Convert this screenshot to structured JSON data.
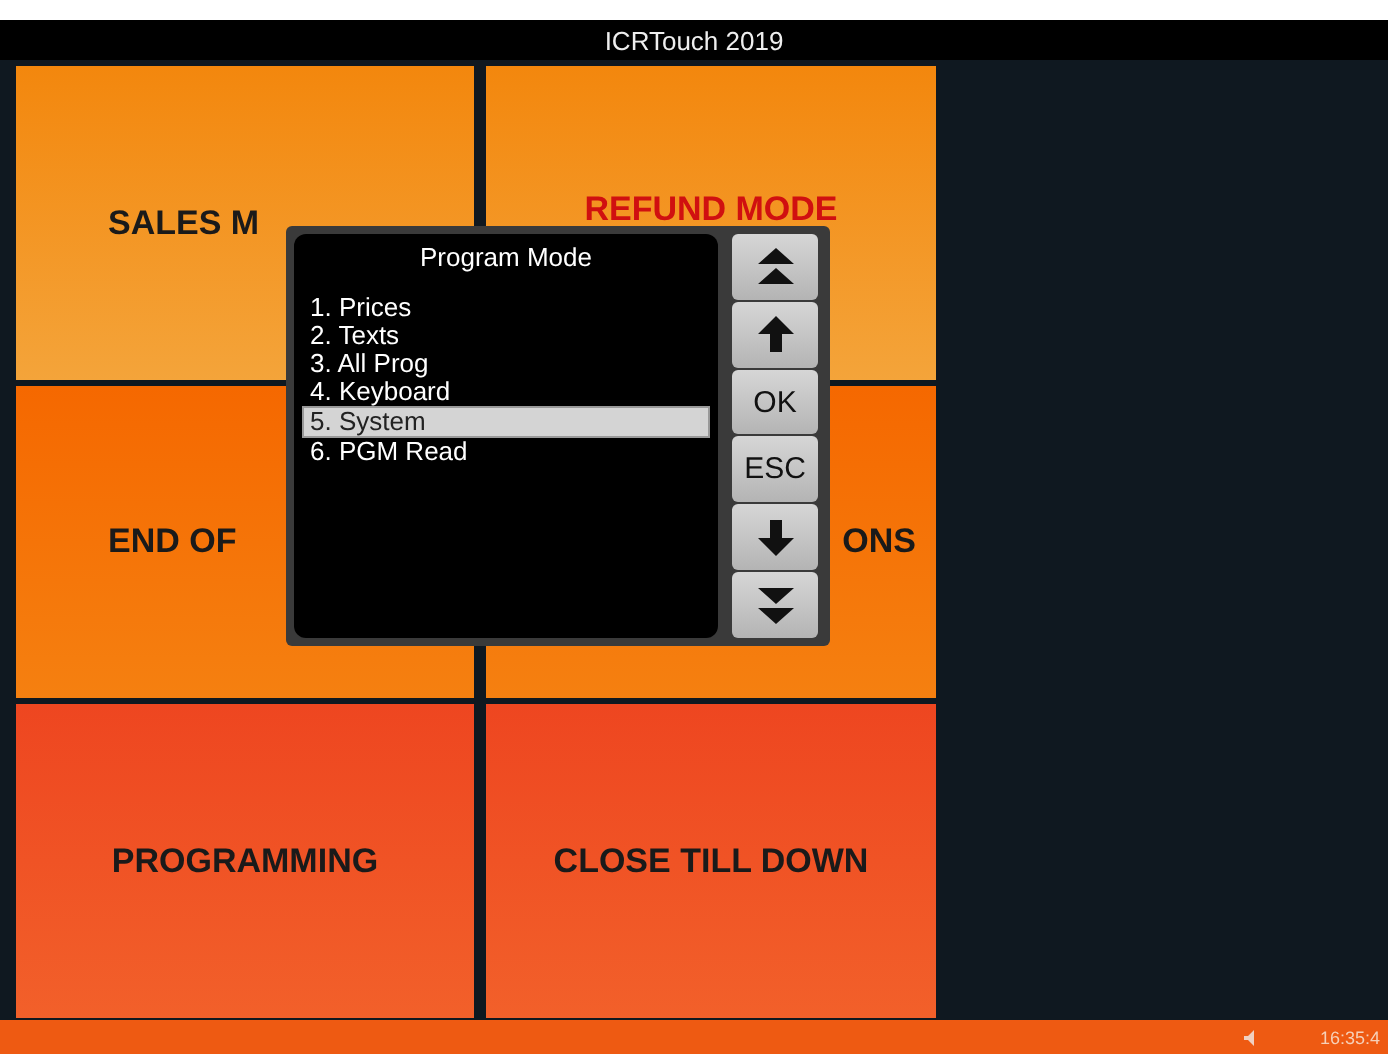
{
  "window": {
    "title": "ICRTouch 2019"
  },
  "tiles": [
    {
      "label": "SALES M",
      "color": "#1a1a1a"
    },
    {
      "label": "REFUND MODE",
      "color": "#d01010"
    },
    {
      "label": "END OF",
      "color": "#1a1a1a"
    },
    {
      "label": "ONS",
      "color": "#1a1a1a"
    },
    {
      "label": "PROGRAMMING",
      "color": "#1a1a1a"
    },
    {
      "label": "CLOSE TILL DOWN",
      "color": "#1a1a1a"
    }
  ],
  "dialog": {
    "title": "Program Mode",
    "items": [
      {
        "label": "1. Prices",
        "selected": false
      },
      {
        "label": "2. Texts",
        "selected": false
      },
      {
        "label": "3. All Prog",
        "selected": false
      },
      {
        "label": "4. Keyboard",
        "selected": false
      },
      {
        "label": "5. System",
        "selected": true
      },
      {
        "label": "6. PGM Read",
        "selected": false
      }
    ],
    "buttons": [
      {
        "kind": "first"
      },
      {
        "kind": "up"
      },
      {
        "kind": "text",
        "label": "OK"
      },
      {
        "kind": "text",
        "label": "ESC"
      },
      {
        "kind": "down"
      },
      {
        "kind": "last"
      }
    ]
  },
  "status_bar": {
    "time": "16:35:4"
  }
}
